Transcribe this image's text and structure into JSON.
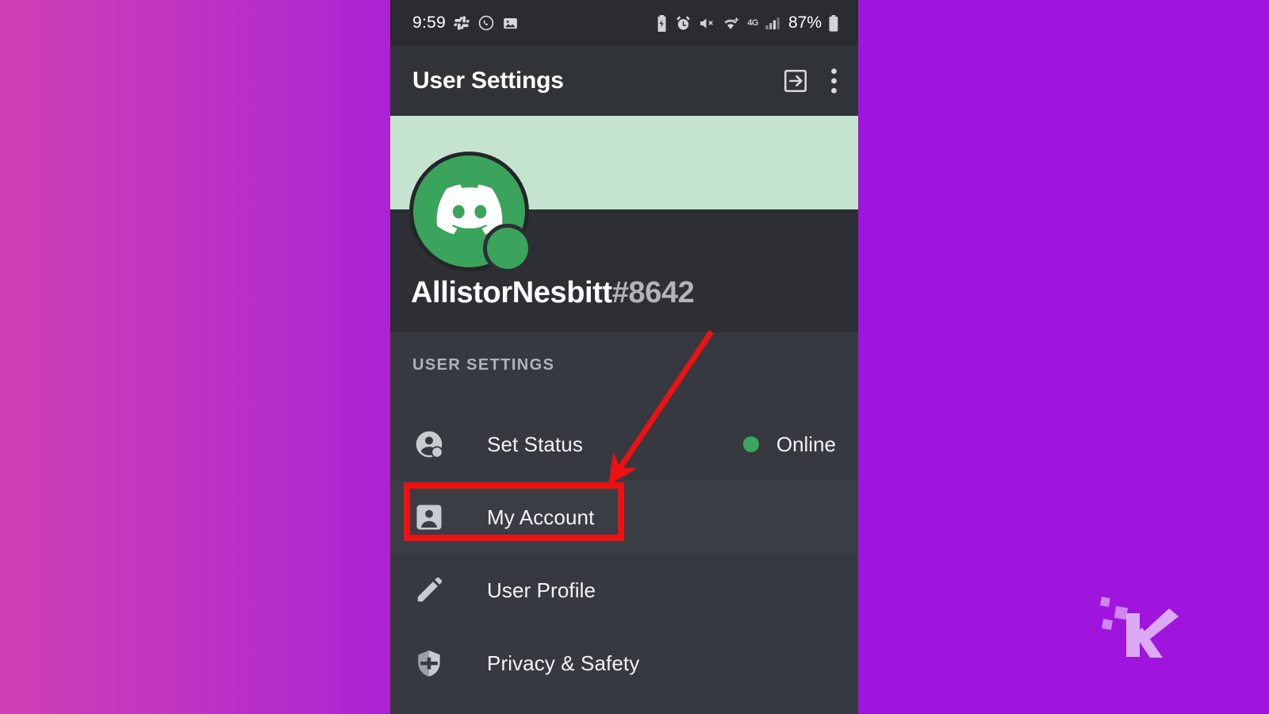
{
  "background": {
    "left_gradient_start": "#cf3fb4",
    "left_gradient_end": "#ab22d4",
    "right_color": "#a015dd"
  },
  "status_bar": {
    "time": "9:59",
    "battery_percent": "87%",
    "network_label": "4G",
    "left_icons": [
      "slack-icon",
      "whatsapp-icon",
      "photo-icon"
    ],
    "right_icons": [
      "battery-saver-icon",
      "alarm-icon",
      "mute-icon",
      "wifi-icon",
      "network-4g-icon",
      "signal-bars-icon",
      "battery-icon"
    ]
  },
  "header": {
    "title": "User Settings",
    "logout_icon": "logout-icon",
    "overflow_icon": "more-vertical-icon"
  },
  "profile": {
    "banner_color": "#c5e4d0",
    "avatar_color": "#3aa35c",
    "avatar_icon": "discord-logo-icon",
    "status_indicator_color": "#3aa35c",
    "username": "AllistorNesbitt",
    "discriminator": "#8642"
  },
  "settings": {
    "section_label": "USER SETTINGS",
    "items": [
      {
        "label": "Set Status",
        "icon": "account-status-icon",
        "value": "Online",
        "value_dot_color": "#3ba55d",
        "highlighted": false
      },
      {
        "label": "My Account",
        "icon": "person-card-icon",
        "value": "",
        "highlighted": true
      },
      {
        "label": "User Profile",
        "icon": "pencil-icon",
        "value": "",
        "highlighted": false
      },
      {
        "label": "Privacy & Safety",
        "icon": "shield-icon",
        "value": "",
        "highlighted": false
      }
    ]
  },
  "annotations": {
    "highlight_box_color": "#ee1111",
    "arrow_color": "#ee1111",
    "arrow_from": "897,418",
    "arrow_to": "768,608"
  },
  "watermark": {
    "letter": "K",
    "color": "#d9a0f0"
  }
}
